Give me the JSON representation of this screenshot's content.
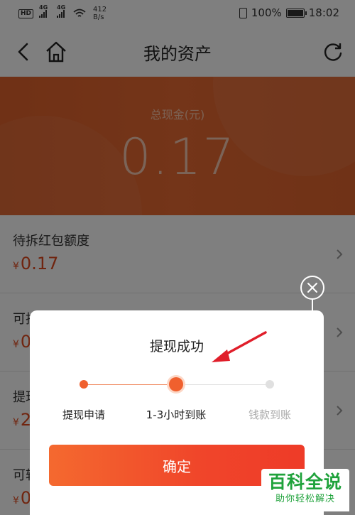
{
  "status_bar": {
    "hd_label": "HD",
    "signal_1_label": "4G",
    "signal_2_label": "4G",
    "net_speed_value": "412",
    "net_speed_unit": "B/s",
    "battery_text": "100%",
    "time": "18:02"
  },
  "nav": {
    "title": "我的资产"
  },
  "banner": {
    "label": "总现金(元)",
    "amount": "0.17"
  },
  "assets": {
    "currency_symbol": "¥",
    "items": [
      {
        "title": "待拆红包额度",
        "value": "0.17"
      },
      {
        "title": "可拆",
        "value": "0"
      },
      {
        "title": "提现",
        "value": "2"
      },
      {
        "title": "可转",
        "value": "0"
      }
    ]
  },
  "dialog": {
    "title": "提现成功",
    "steps": [
      {
        "label": "提现申请",
        "state": "done"
      },
      {
        "label": "1-3小时到账",
        "state": "current"
      },
      {
        "label": "钱款到账",
        "state": "pending"
      }
    ],
    "confirm_label": "确定"
  },
  "watermark": {
    "main": "百科全说",
    "sub": "助你轻松解决"
  },
  "colors": {
    "accent": "#f0602e",
    "banner": "#e0622c",
    "amount_red": "#e04a1f",
    "watermark_green": "#1fa23b",
    "annotation_red": "#e01e2a"
  }
}
